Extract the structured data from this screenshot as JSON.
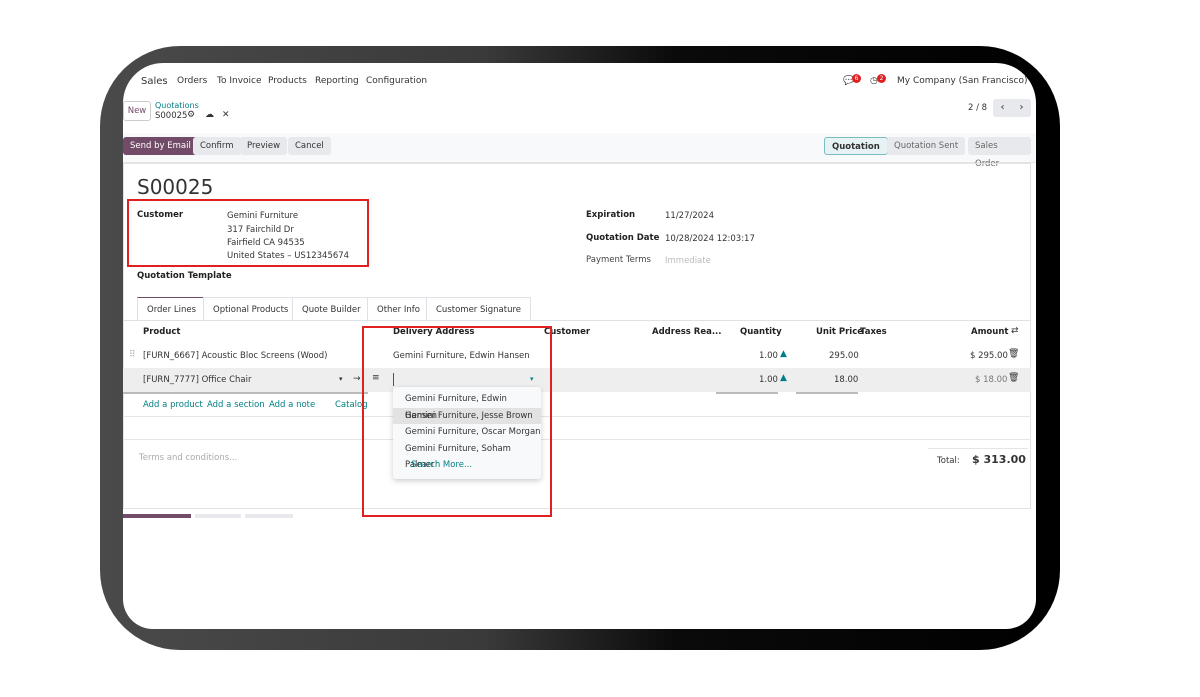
{
  "nav": {
    "app": "Sales",
    "items": [
      "Orders",
      "To Invoice",
      "Products",
      "Reporting",
      "Configuration"
    ],
    "messages_count": "6",
    "activities_count": "2",
    "company": "My Company (San Francisco)"
  },
  "breadcrumb": {
    "new": "New",
    "parent": "Quotations",
    "current": "S00025"
  },
  "pager": "2 / 8",
  "actions": {
    "send": "Send by Email",
    "confirm": "Confirm",
    "preview": "Preview",
    "cancel": "Cancel"
  },
  "status": [
    "Quotation",
    "Quotation Sent",
    "Sales Order"
  ],
  "form": {
    "title": "S00025",
    "customer_label": "Customer",
    "customer_lines": [
      "Gemini Furniture",
      "317 Fairchild Dr",
      "Fairfield CA 94535",
      "United States – US12345674"
    ],
    "template_label": "Quotation Template",
    "expiration_label": "Expiration",
    "expiration": "11/27/2024",
    "qdate_label": "Quotation Date",
    "qdate": "10/28/2024 12:03:17",
    "terms_label": "Payment Terms",
    "terms_placeholder": "Immediate"
  },
  "tabs": [
    "Order Lines",
    "Optional Products",
    "Quote Builder",
    "Other Info",
    "Customer Signature"
  ],
  "columns": {
    "product": "Product",
    "delivery": "Delivery Address",
    "customer": "Customer",
    "address_rea": "Address Rea...",
    "qty": "Quantity",
    "price": "Unit Price",
    "taxes": "Taxes",
    "amount": "Amount"
  },
  "rows": [
    {
      "product": "[FURN_6667] Acoustic Bloc Screens (Wood)",
      "delivery": "Gemini Furniture, Edwin Hansen",
      "qty": "1.00",
      "price": "295.00",
      "amount": "$ 295.00"
    },
    {
      "product": "[FURN_7777] Office Chair",
      "delivery": "",
      "qty": "1.00",
      "price": "18.00",
      "amount": "$ 18.00"
    }
  ],
  "add_links": [
    "Add a product",
    "Add a section",
    "Add a note",
    "Catalog"
  ],
  "dropdown": [
    "Gemini Furniture, Edwin Hansen",
    "Gemini Furniture, Jesse Brown",
    "Gemini Furniture, Oscar Morgan",
    "Gemini Furniture, Soham Palmer"
  ],
  "search_more": "Search More...",
  "terms_placeholder": "Terms and conditions...",
  "total_label": "Total:",
  "total": "$ 313.00"
}
